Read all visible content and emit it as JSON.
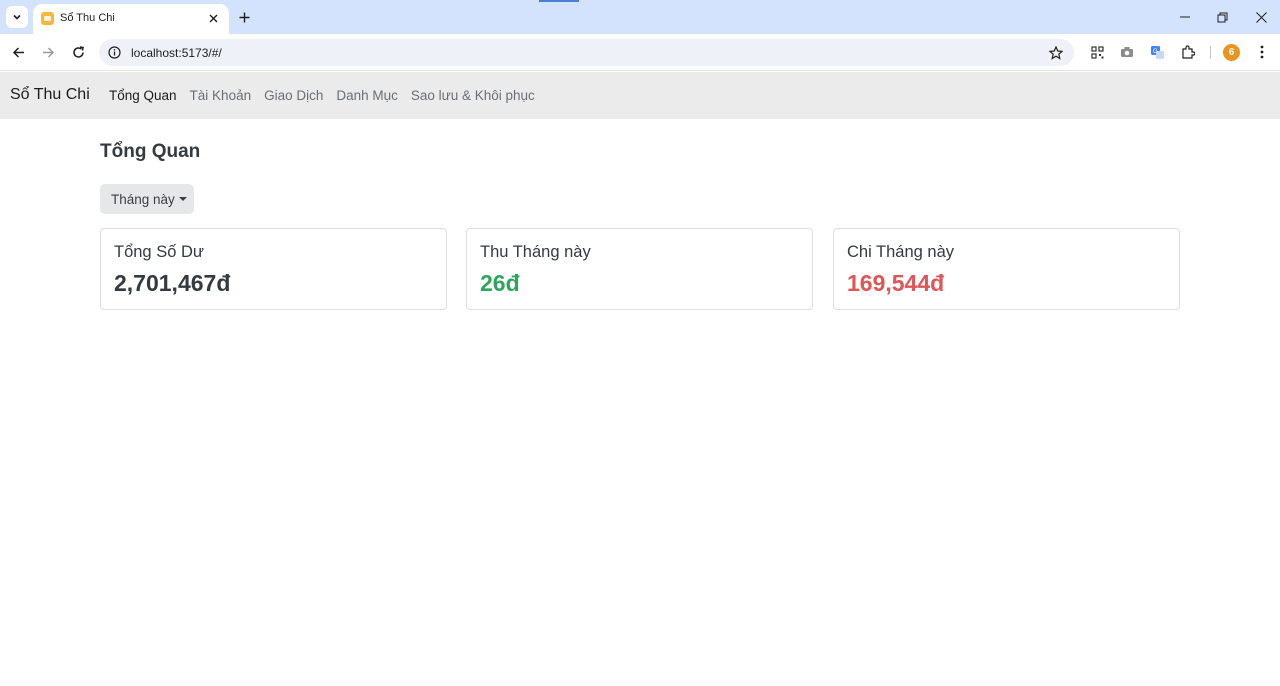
{
  "browser": {
    "tab_title": "Sổ Thu Chi",
    "url": "localhost:5173/#/",
    "profile_initial": "6"
  },
  "navbar": {
    "brand": "Sổ Thu Chi",
    "links": [
      "Tổng Quan",
      "Tài Khoản",
      "Giao Dịch",
      "Danh Mục",
      "Sao lưu & Khôi phục"
    ]
  },
  "page": {
    "title": "Tổng Quan",
    "period_dropdown": "Tháng này"
  },
  "cards": [
    {
      "title": "Tổng Số Dư",
      "value": "2,701,467đ",
      "color": "#343a40"
    },
    {
      "title": "Thu Tháng này",
      "value": "26đ",
      "color": "#2ea55a"
    },
    {
      "title": "Chi Tháng này",
      "value": "169,544đ",
      "color": "#e05555"
    }
  ],
  "icons": [
    "tab-search-icon",
    "favicon-icon",
    "close-icon",
    "plus-icon",
    "minimize-icon",
    "restore-icon",
    "close-window-icon",
    "back-arrow-icon",
    "forward-arrow-icon",
    "reload-icon",
    "info-icon",
    "star-icon",
    "qr-code-icon",
    "camera-icon",
    "translate-icon",
    "extensions-icon",
    "menu-dots-icon"
  ]
}
